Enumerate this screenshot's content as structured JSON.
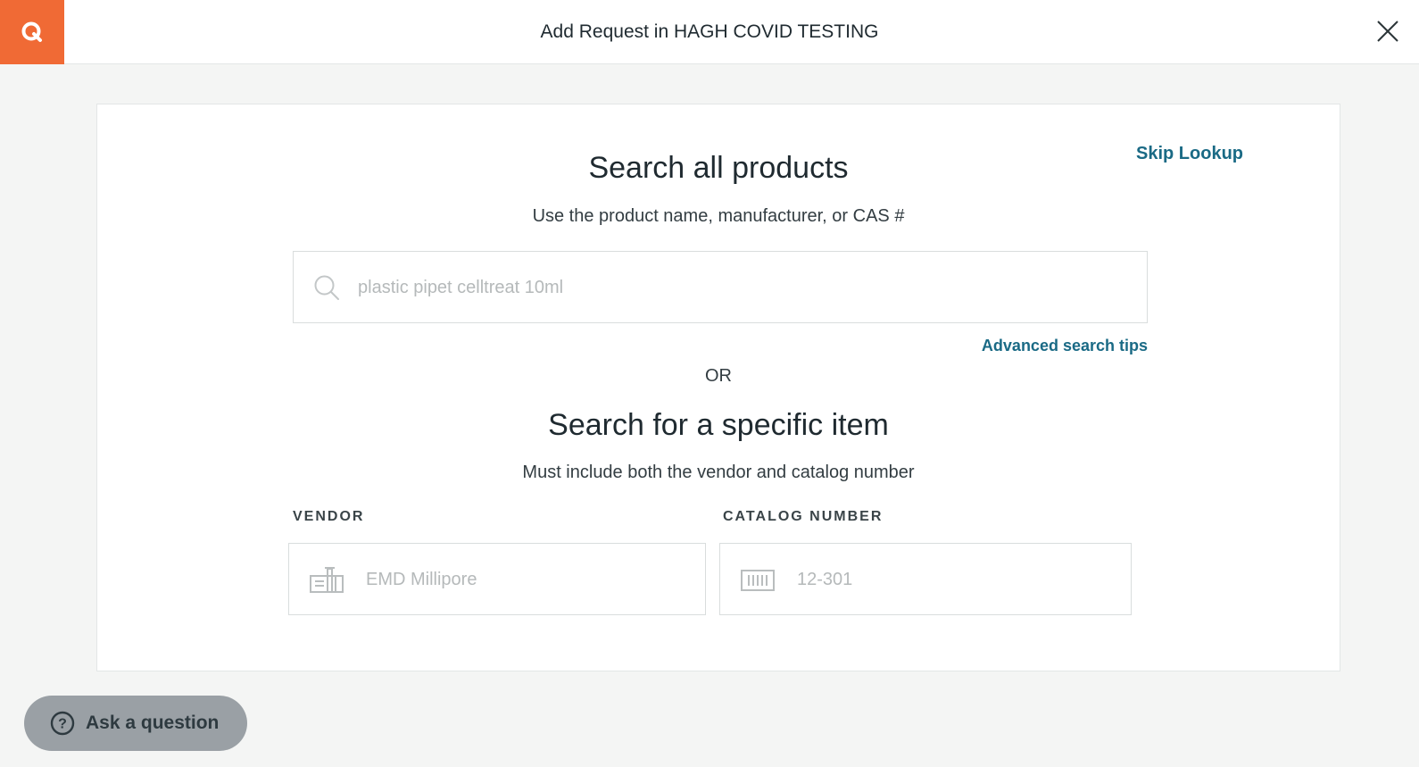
{
  "header": {
    "title": "Add Request in HAGH COVID TESTING",
    "logo_icon": "quartzy-q-logo",
    "close_icon": "close-icon",
    "brand_color": "#f06a35"
  },
  "search_all": {
    "title": "Search all products",
    "subtitle": "Use the product name, manufacturer, or CAS #",
    "skip_label": "Skip Lookup",
    "placeholder": "plastic pipet celltreat 10ml",
    "advanced_tips_label": "Advanced search tips"
  },
  "divider": {
    "or_label": "OR"
  },
  "search_specific": {
    "title": "Search for a specific item",
    "subtitle": "Must include both the vendor and catalog number",
    "vendor_label": "VENDOR",
    "vendor_placeholder": "EMD Millipore",
    "catalog_label": "CATALOG NUMBER",
    "catalog_placeholder": "12-301"
  },
  "help": {
    "ask_label": "Ask a question"
  },
  "colors": {
    "link": "#1a6a85",
    "background": "#f4f5f4"
  }
}
